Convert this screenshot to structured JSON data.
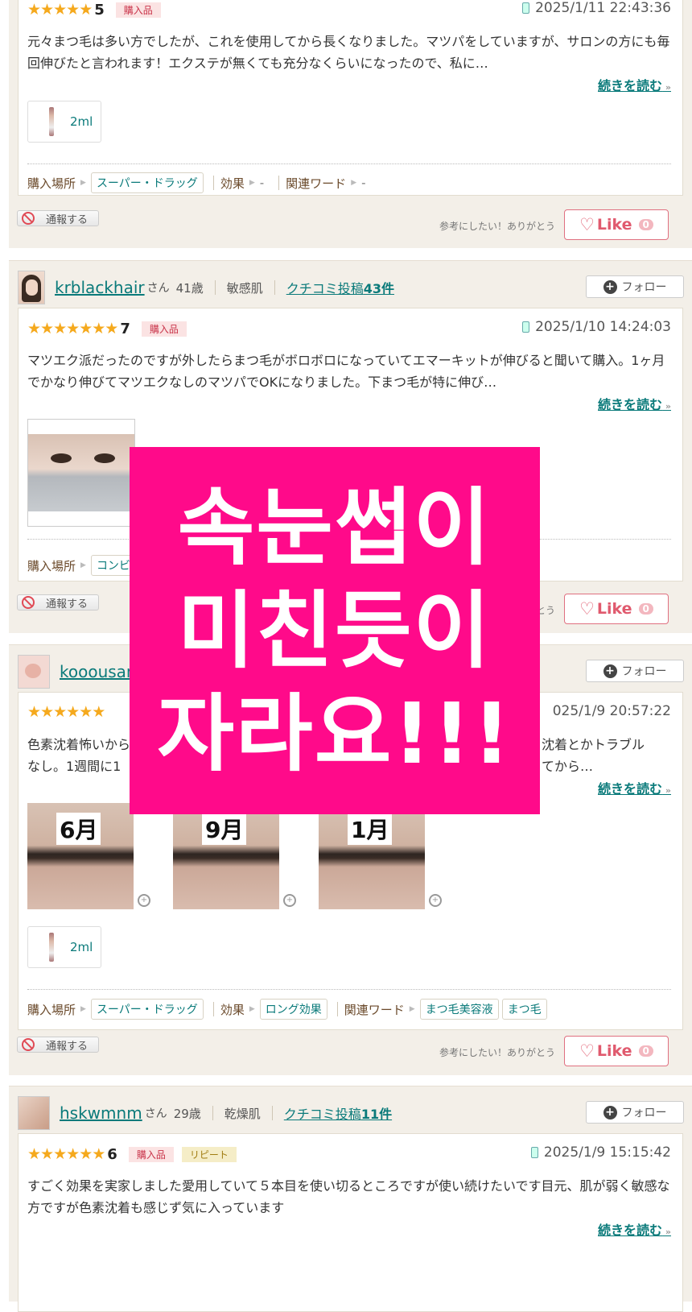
{
  "reviews": [
    {
      "score": "5",
      "badge": "購入品",
      "date": "2025/1/11 22:43:36",
      "text": "元々まつ毛は多い方でしたが、これを使用してから長くなりました。マツパをしていますが、サロンの方にも毎回伸びたと言われます！エクステが無くても充分なくらいになったので、私に…",
      "more": "続きを読む",
      "product_size": "2ml",
      "purchase_label": "購入場所",
      "purchase_value": "スーパー・ドラッグ",
      "effect_label": "効果",
      "effect_value": "-",
      "words_label": "関連ワード",
      "words_value": "-",
      "report": "通報する",
      "helpful": "参考にしたい！ありがとう",
      "like": "Like",
      "like_count": "0"
    },
    {
      "user": "krblackhair",
      "san": "さん",
      "age": "41歳",
      "skin": "敏感肌",
      "posts": "クチコミ投稿",
      "posts_count": "43件",
      "follow": "フォロー",
      "score": "7",
      "badge": "購入品",
      "date": "2025/1/10 14:24:03",
      "text": "マツエク派だったのですが外したらまつ毛がボロボロになっていてエマーキットが伸びると聞いて購入。1ヶ月でかなり伸びてマツエクなしのマツパでOKになりました。下まつ毛が特に伸び…",
      "more": "続きを読む",
      "purchase_label": "購入場所",
      "purchase_value": "コンビ",
      "report": "通報する",
      "helpful_tail": "とう",
      "like": "Like",
      "like_count": "0"
    },
    {
      "user": "kooousan",
      "follow": "フォロー",
      "date": "025/1/9 20:57:22",
      "text_left_1": "色素沈着怖いから",
      "text_left_2": "なし。1週間に1",
      "text_right_1": "沈着とかトラブル",
      "text_right_2": "てから…",
      "more": "続きを読む",
      "photos": [
        "6月",
        "9月",
        "1月"
      ],
      "product_size": "2ml",
      "purchase_label": "購入場所",
      "purchase_value": "スーパー・ドラッグ",
      "effect_label": "効果",
      "effect_value": "ロング効果",
      "words_label": "関連ワード",
      "words_value_1": "まつ毛美容液",
      "words_value_2": "まつ毛",
      "report": "通報する",
      "helpful": "参考にしたい！ありがとう",
      "like": "Like",
      "like_count": "0"
    },
    {
      "user": "hskwmnm",
      "san": "さん",
      "age": "29歳",
      "skin": "乾燥肌",
      "posts": "クチコミ投稿",
      "posts_count": "11件",
      "follow": "フォロー",
      "score": "6",
      "badge": "購入品",
      "badge2": "リピート",
      "date": "2025/1/9 15:15:42",
      "text": "すごく効果を実家しました愛用していて５本目を使い切るところですが使い続けたいです目元、肌が弱く敏感な方ですが色素沈着も感じず気に入っています",
      "more": "続きを読む"
    }
  ],
  "overlay": [
    "속눈썹이",
    "미친듯이",
    "자라요!!!"
  ],
  "colors": {
    "accent": "#0a7a7a",
    "overlay_bg": "#ff0a8a",
    "star": "#f5a91d",
    "like": "#e05a6e"
  }
}
